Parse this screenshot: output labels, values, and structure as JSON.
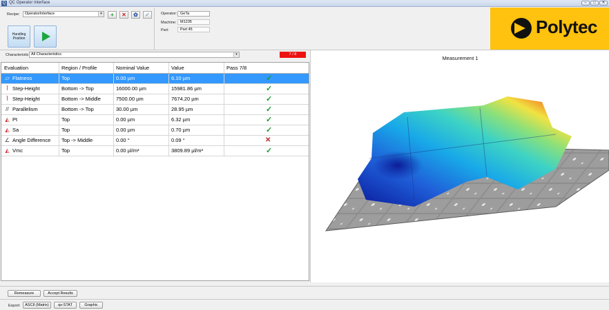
{
  "window": {
    "title": "QC Operator Interface",
    "app_icon": "app-icon"
  },
  "toolbar": {
    "recipe_label": "Recipe:",
    "recipe_value": "OperatorInterface",
    "buttons": [
      {
        "name": "add-recipe-button",
        "icon": "plus-icon",
        "glyph": "+",
        "color": "#1a9b2c"
      },
      {
        "name": "delete-recipe-button",
        "icon": "delete-x-icon",
        "glyph": "✕",
        "color": "#c4242a"
      },
      {
        "name": "settings-button",
        "icon": "gear-icon",
        "glyph": "✿",
        "color": "#2a4c9b"
      },
      {
        "name": "accept-recipe-button",
        "icon": "check-icon",
        "glyph": "✓",
        "color": "#8aa0bb"
      }
    ],
    "handling_label": "Handling\nPosition"
  },
  "info": {
    "operator_label": "Operator:",
    "operator_value": "GeTa",
    "machine_label": "Machine:",
    "machine_value": "M1235",
    "part_label": "Part:",
    "part_value": "Part 45"
  },
  "brand": {
    "name": "Polytec",
    "color": "#ffc20e"
  },
  "characteristic": {
    "label": "Characteristic:",
    "value": "All Characteristics",
    "pass_badge": "7 / 8",
    "badge_color": "#ee1111"
  },
  "table": {
    "headers": [
      "Evaluation",
      "Region / Profile",
      "Nominal Value",
      "Value",
      "Pass 7/8"
    ],
    "rows": [
      {
        "icon": "flatness-icon",
        "glyph": "▱",
        "eval": "Flatness",
        "region": "Top",
        "nominal": "0.00 µm",
        "value": "6.10 µm",
        "pass": true,
        "selected": true
      },
      {
        "icon": "step-height-icon",
        "glyph": "Ī",
        "eval": "Step-Height",
        "region": "Bottom -> Top",
        "nominal": "16000.00 µm",
        "value": "15981.86 µm",
        "pass": true
      },
      {
        "icon": "step-height-icon",
        "glyph": "Ī",
        "eval": "Step-Height",
        "region": "Bottom -> Middle",
        "nominal": "7500.00 µm",
        "value": "7674.20 µm",
        "pass": true
      },
      {
        "icon": "parallelism-icon",
        "glyph": "//",
        "eval": "Parallelism",
        "region": "Bottom -> Top",
        "nominal": "30.00 µm",
        "value": "28.95 µm",
        "pass": true
      },
      {
        "icon": "roughness-icon",
        "glyph": "◭",
        "eval": "Pt",
        "region": "Top",
        "nominal": "0.00 µm",
        "value": "6.32 µm",
        "pass": true
      },
      {
        "icon": "roughness-icon",
        "glyph": "◭",
        "eval": "Sa",
        "region": "Top",
        "nominal": "0.00 µm",
        "value": "0.70 µm",
        "pass": true
      },
      {
        "icon": "angle-icon",
        "glyph": "∠",
        "eval": "Angle Difference",
        "region": "Top -> Middle",
        "nominal": "0.00 °",
        "value": "0.09 °",
        "pass": false
      },
      {
        "icon": "volume-icon",
        "glyph": "◭",
        "eval": "Vmc",
        "region": "Top",
        "nominal": "0.00 µl/m²",
        "value": "3809.89 µl/m²",
        "pass": true
      }
    ]
  },
  "measurement": {
    "title": "Measurement 1"
  },
  "actions": {
    "remeasure": "Remeasure",
    "accept": "Accept Results"
  },
  "export": {
    "label": "Export:",
    "ascii": "ASCII (Matrix)",
    "qs_stat": "qs-STAT",
    "graphic": "Graphic"
  }
}
